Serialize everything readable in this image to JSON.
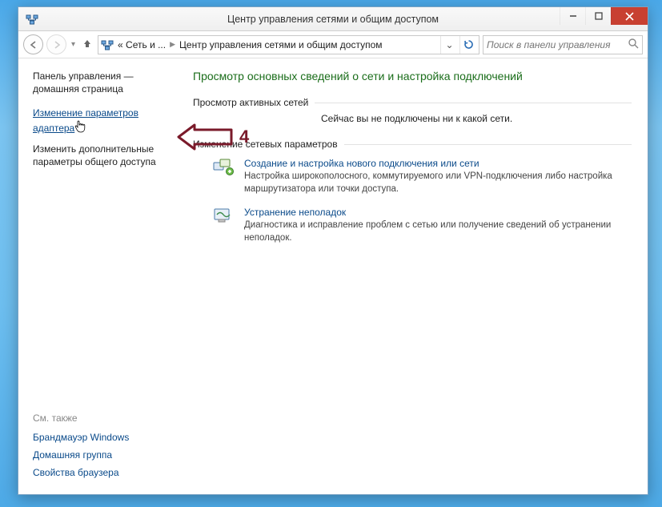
{
  "titlebar": {
    "title": "Центр управления сетями и общим доступом"
  },
  "nav": {
    "seg1": "« Сеть и ...",
    "seg2": "Центр управления сетями и общим доступом",
    "search_placeholder": "Поиск в панели управления"
  },
  "sidebar": {
    "home": "Панель управления — домашняя страница",
    "link_adapter": "Изменение параметров адаптера",
    "link_sharing": "Изменить дополнительные параметры общего доступа",
    "see_also": "См. также",
    "firewall": "Брандмауэр Windows",
    "homegroup": "Домашняя группа",
    "browser": "Свойства браузера"
  },
  "main": {
    "heading": "Просмотр основных сведений о сети и настройка подключений",
    "active_label": "Просмотр активных сетей",
    "not_connected": "Сейчас вы не подключены ни к какой сети.",
    "change_label": "Изменение сетевых параметров",
    "item1_title": "Создание и настройка нового подключения или сети",
    "item1_desc": "Настройка широкополосного, коммутируемого или VPN-подключения либо настройка маршрутизатора или точки доступа.",
    "item2_title": "Устранение неполадок",
    "item2_desc": "Диагностика и исправление проблем с сетью или получение сведений об устранении неполадок."
  },
  "annotation": {
    "label": "4"
  }
}
